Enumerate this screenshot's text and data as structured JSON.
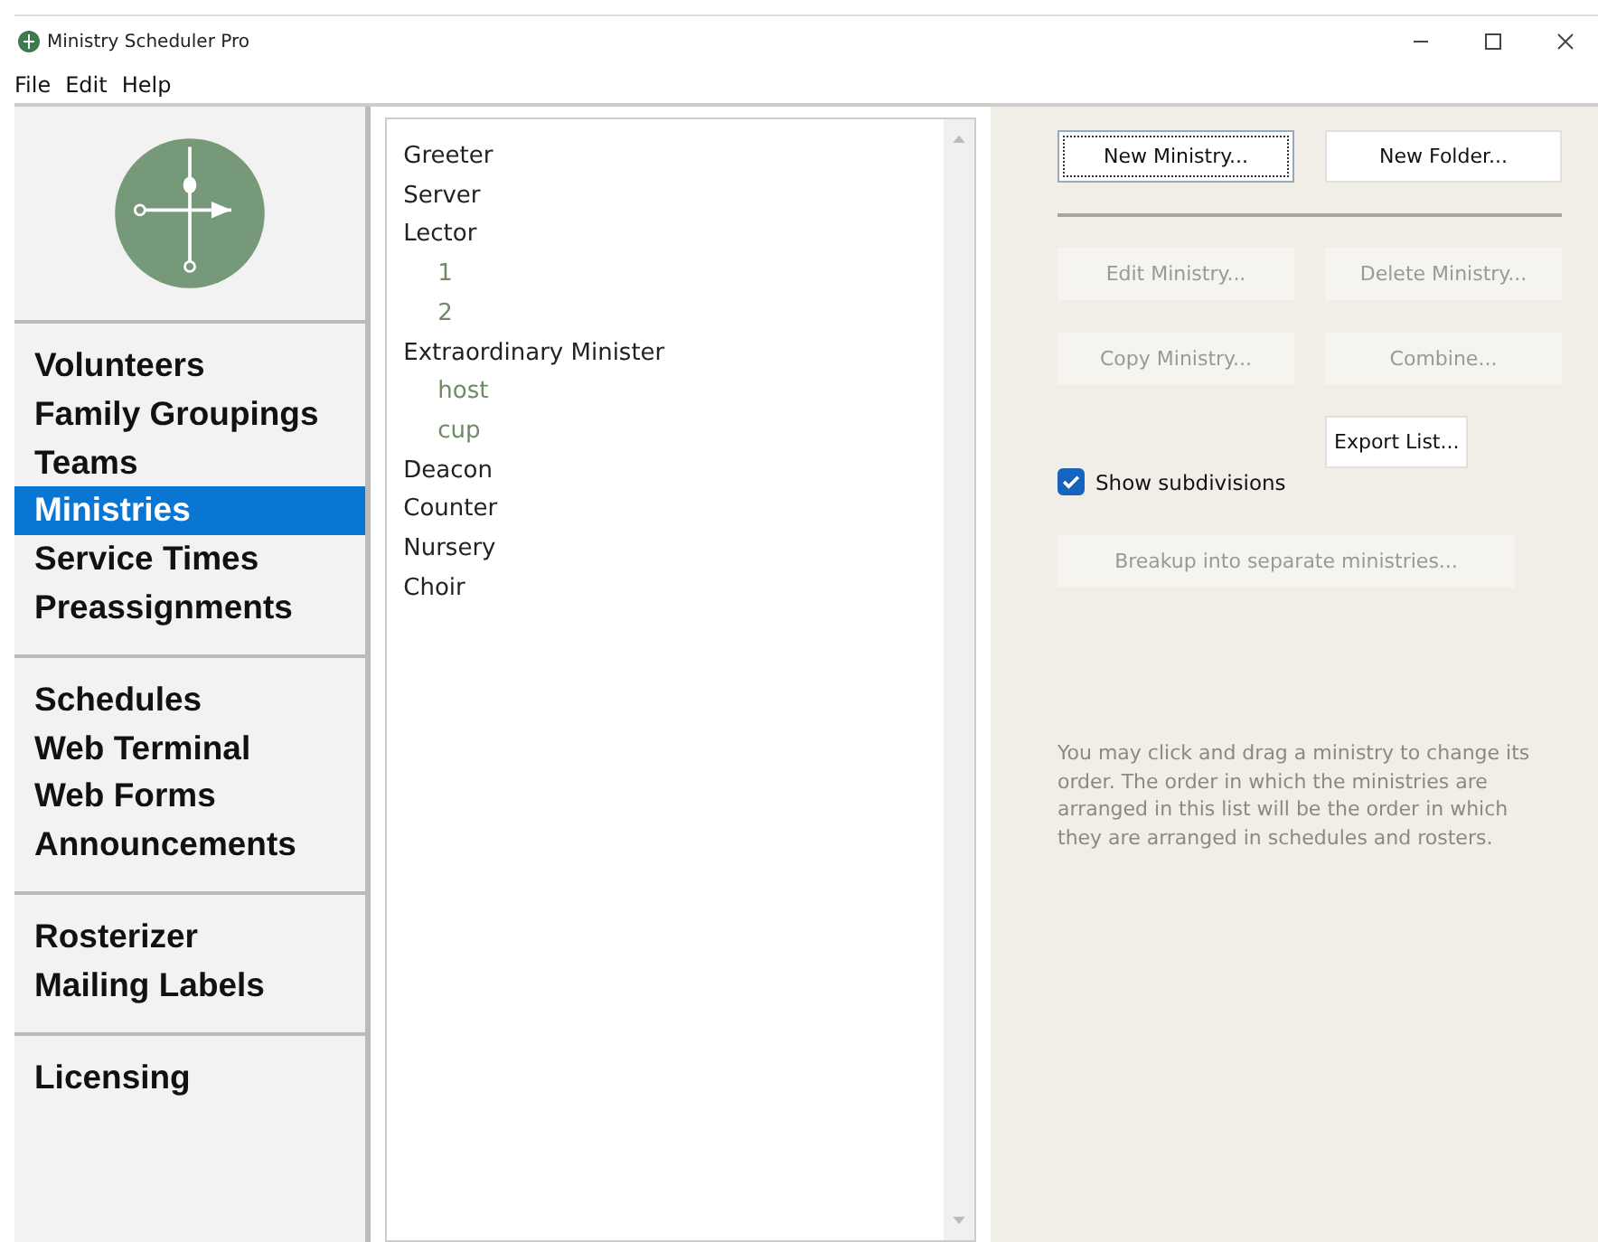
{
  "window": {
    "title": "Ministry Scheduler Pro"
  },
  "menu": [
    "File",
    "Edit",
    "Help"
  ],
  "sidebar": {
    "groups": [
      {
        "items": [
          {
            "label": "Volunteers",
            "selected": false
          },
          {
            "label": "Family Groupings",
            "selected": false
          },
          {
            "label": "Teams",
            "selected": false
          },
          {
            "label": "Ministries",
            "selected": true
          },
          {
            "label": "Service Times",
            "selected": false
          },
          {
            "label": "Preassignments",
            "selected": false
          }
        ]
      },
      {
        "items": [
          {
            "label": "Schedules",
            "selected": false
          },
          {
            "label": "Web Terminal",
            "selected": false
          },
          {
            "label": "Web Forms",
            "selected": false
          },
          {
            "label": "Announcements",
            "selected": false
          }
        ]
      },
      {
        "items": [
          {
            "label": "Rosterizer",
            "selected": false
          },
          {
            "label": "Mailing Labels",
            "selected": false
          }
        ]
      },
      {
        "items": [
          {
            "label": "Licensing",
            "selected": false
          }
        ]
      }
    ]
  },
  "ministries": [
    {
      "label": "Greeter"
    },
    {
      "label": "Server"
    },
    {
      "label": "Lector",
      "children": [
        {
          "label": "1"
        },
        {
          "label": "2"
        }
      ]
    },
    {
      "label": "Extraordinary Minister",
      "children": [
        {
          "label": "host"
        },
        {
          "label": "cup"
        }
      ]
    },
    {
      "label": "Deacon"
    },
    {
      "label": "Counter"
    },
    {
      "label": "Nursery"
    },
    {
      "label": "Choir"
    }
  ],
  "buttons_top": [
    {
      "label": "New Ministry...",
      "disabled": false,
      "focused": true
    },
    {
      "label": "New Folder...",
      "disabled": false,
      "focused": false
    }
  ],
  "buttons_mid": [
    {
      "label": "Edit Ministry...",
      "disabled": true,
      "focused": false
    },
    {
      "label": "Delete Ministry...",
      "disabled": true,
      "focused": false
    },
    {
      "label": "Copy Ministry...",
      "disabled": true,
      "focused": false
    },
    {
      "label": "Combine...",
      "disabled": true,
      "focused": false
    }
  ],
  "export_button": {
    "label": "Export List...",
    "disabled": false,
    "focused": false
  },
  "show_subdivisions": {
    "label": "Show subdivisions",
    "checked": true
  },
  "breakup_button": {
    "label": "Breakup into separate ministries...",
    "disabled": true,
    "focused": false
  },
  "help_text": "You may click and drag a ministry to change its order. The order in which the ministries are arranged in this list will be the order in which they are arranged in schedules and rosters."
}
